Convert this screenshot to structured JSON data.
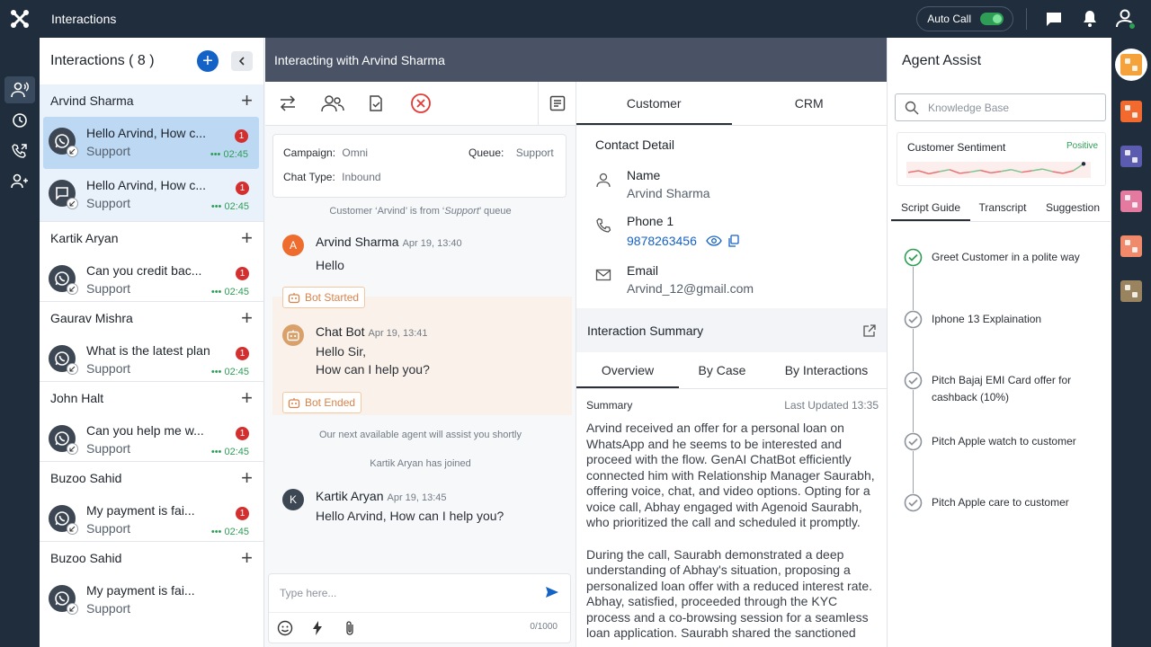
{
  "topbar": {
    "title": "Interactions",
    "auto_call_label": "Auto Call"
  },
  "list": {
    "title": "Interactions ( 8 )",
    "groups": [
      {
        "name": "Arvind Sharma",
        "items": [
          {
            "message": "Hello Arvind, How c...",
            "queue": "Support",
            "badge": "1",
            "time": "02:45",
            "channel": "whatsapp-icon"
          },
          {
            "message": "Hello Arvind, How c...",
            "queue": "Support",
            "badge": "1",
            "time": "02:45",
            "channel": "chat-icon"
          }
        ]
      },
      {
        "name": "Kartik Aryan",
        "items": [
          {
            "message": "Can you credit bac...",
            "queue": "Support",
            "badge": "1",
            "time": "02:45",
            "channel": "whatsapp-icon"
          }
        ]
      },
      {
        "name": "Gaurav Mishra",
        "items": [
          {
            "message": "What is the latest plan",
            "queue": "Support",
            "badge": "1",
            "time": "02:45",
            "channel": "whatsapp-icon"
          }
        ]
      },
      {
        "name": "John Halt",
        "items": [
          {
            "message": "Can you help me w...",
            "queue": "Support",
            "badge": "1",
            "time": "02:45",
            "channel": "whatsapp-icon"
          }
        ]
      },
      {
        "name": "Buzoo Sahid",
        "items": [
          {
            "message": "My payment is fai...",
            "queue": "Support",
            "badge": "1",
            "time": "02:45",
            "channel": "whatsapp-icon"
          }
        ]
      },
      {
        "name": "Buzoo Sahid",
        "items": [
          {
            "message": "My payment is fai...",
            "queue": "Support",
            "badge": "",
            "time": "",
            "channel": "whatsapp-icon"
          }
        ]
      }
    ]
  },
  "chat": {
    "header": "Interacting with Arvind Sharma",
    "info": {
      "campaign_label": "Campaign:",
      "campaign_value": "Omni",
      "queue_label": "Queue:",
      "queue_value": "Support",
      "chat_type_label": "Chat Type:",
      "chat_type_value": "Inbound"
    },
    "note_queue_prefix": "Customer ‘Arvind’ is from ‘",
    "note_queue_name": "Support",
    "note_queue_suffix": "’ queue",
    "messages": [
      {
        "initial": "A",
        "name": "Arvind Sharma",
        "time": "Apr 19, 13:40",
        "text": "Hello"
      },
      {
        "initial": "",
        "name": "Chat Bot",
        "time": "Apr 19, 13:41",
        "text_1": "Hello Sir,",
        "text_2": "How can I help you?"
      },
      {
        "initial": "K",
        "name": "Kartik Aryan",
        "time": "Apr 19, 13:45",
        "text": "Hello Arvind, How can I help you?"
      }
    ],
    "bot_started": "Bot Started",
    "bot_ended": "Bot Ended",
    "note_agent": "Our next available agent will assist you shortly",
    "note_joined": "Kartik Aryan has joined",
    "composer_placeholder": "Type here...",
    "char_count": "0/1000"
  },
  "details": {
    "tabs": [
      "Customer",
      "CRM"
    ],
    "contact_title": "Contact Detail",
    "name_label": "Name",
    "name_value": "Arvind Sharma",
    "phone_label": "Phone 1",
    "phone_value": "9878263456",
    "email_label": "Email",
    "email_value": "Arvind_12@gmail.com",
    "summary_title": "Interaction Summary",
    "summary_tabs": [
      "Overview",
      "By Case",
      "By Interactions"
    ],
    "summary_label": "Summary",
    "last_updated": "Last Updated 13:35",
    "summary_p1": "Arvind received an offer for a personal loan on WhatsApp and he seems to be interested and proceed with the flow. GenAI ChatBot efficiently connected him with Relationship Manager Saurabh, offering voice, chat, and video options. Opting for a voice call, Abhay engaged with Agenoid Saurabh, who prioritized the call and scheduled it promptly.",
    "summary_p2": "During the call, Saurabh demonstrated a deep understanding of Abhay's situation, proposing a personalized loan offer with a reduced interest rate. Abhay, satisfied, proceeded through the KYC process and a co-browsing session for a seamless loan application. Saurabh shared the sanctioned"
  },
  "assist": {
    "title": "Agent Assist",
    "search_placeholder": "Knowledge Base",
    "sentiment_label": "Customer Sentiment",
    "sentiment_value": "Positive",
    "sentiment_trend": [
      0.42,
      0.5,
      0.36,
      0.46,
      0.55,
      0.38,
      0.44,
      0.52,
      0.4,
      0.47,
      0.55,
      0.43,
      0.5,
      0.58,
      0.46,
      0.38,
      0.5,
      0.82
    ],
    "tabs": [
      "Script Guide",
      "Transcript",
      "Suggestion"
    ],
    "steps": [
      {
        "text": "Greet Customer in a polite way",
        "done": true
      },
      {
        "text": "Iphone 13 Explaination",
        "done": false
      },
      {
        "text": "Pitch Bajaj EMI Card offer for cashback (10%)",
        "done": false
      },
      {
        "text": "Pitch Apple watch to customer",
        "done": false
      },
      {
        "text": "Pitch Apple care to customer",
        "done": false
      }
    ]
  },
  "colors": {
    "nav": "#1f2d3d",
    "accent": "#1562c6",
    "badge": "#d32f2f",
    "online": "#2e9e56",
    "app_tiles": [
      "#f26a2e",
      "#5b5bb0",
      "#e57aa0",
      "#f08a6a",
      "#9a8460"
    ]
  }
}
